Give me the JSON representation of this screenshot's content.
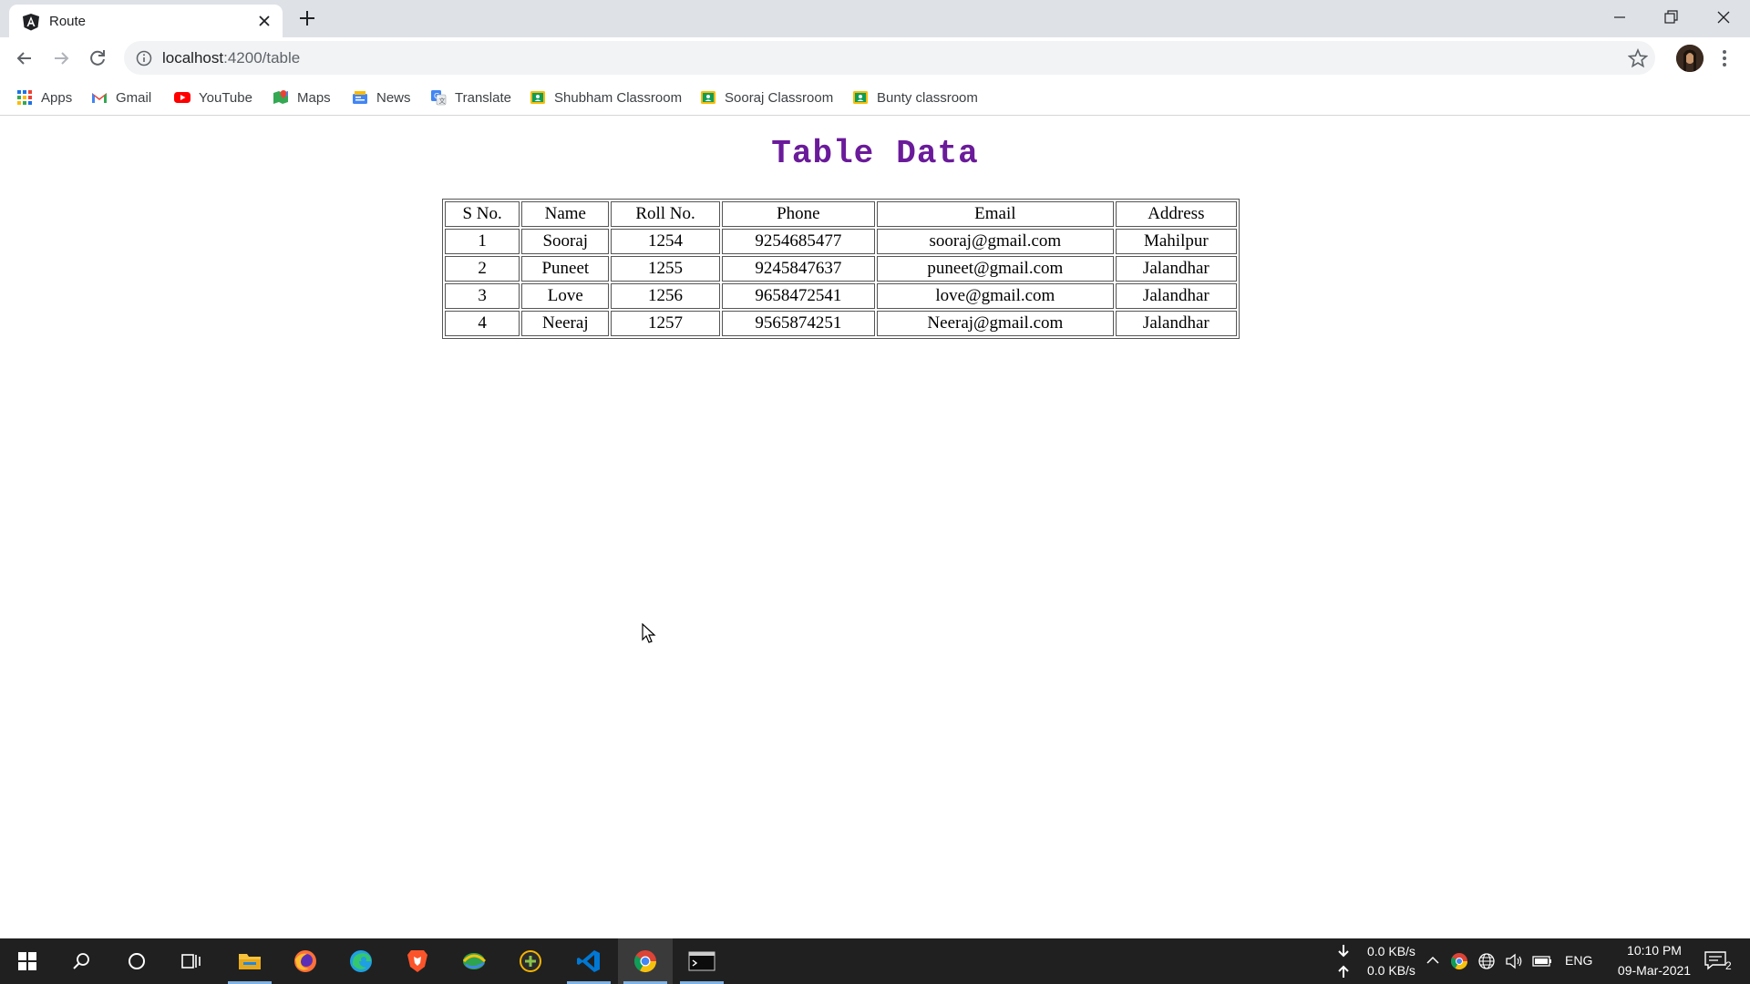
{
  "browser": {
    "tab": {
      "title": "Route"
    },
    "address": {
      "host": "localhost",
      "path": ":4200/table"
    },
    "bookmarks": [
      {
        "label": "Apps",
        "icon": "apps-grid-icon"
      },
      {
        "label": "Gmail",
        "icon": "gmail-icon"
      },
      {
        "label": "YouTube",
        "icon": "youtube-icon"
      },
      {
        "label": "Maps",
        "icon": "maps-icon"
      },
      {
        "label": "News",
        "icon": "news-icon"
      },
      {
        "label": "Translate",
        "icon": "translate-icon"
      },
      {
        "label": "Shubham Classroom",
        "icon": "classroom-icon"
      },
      {
        "label": "Sooraj Classroom",
        "icon": "classroom-icon"
      },
      {
        "label": "Bunty classroom",
        "icon": "classroom-icon"
      }
    ]
  },
  "page": {
    "title_word1": "Table",
    "title_word2": "Data",
    "table": {
      "headers": [
        "S No.",
        "Name",
        "Roll No.",
        "Phone",
        "Email",
        "Address"
      ],
      "rows": [
        [
          "1",
          "Sooraj",
          "1254",
          "9254685477",
          "sooraj@gmail.com",
          "Mahilpur"
        ],
        [
          "2",
          "Puneet",
          "1255",
          "9245847637",
          "puneet@gmail.com",
          "Jalandhar"
        ],
        [
          "3",
          "Love",
          "1256",
          "9658472541",
          "love@gmail.com",
          "Jalandhar"
        ],
        [
          "4",
          "Neeraj",
          "1257",
          "9565874251",
          "Neeraj@gmail.com",
          "Jalandhar"
        ]
      ]
    }
  },
  "taskbar": {
    "net_down": "0.0 KB/s",
    "net_up": "0.0 KB/s",
    "language": "ENG",
    "time": "10:10 PM",
    "date": "09-Mar-2021",
    "notification_count": "2"
  },
  "colors": {
    "title_color": "#6a1b9a",
    "tabstrip_bg": "#dee1e6",
    "taskbar_bg": "#202020"
  }
}
